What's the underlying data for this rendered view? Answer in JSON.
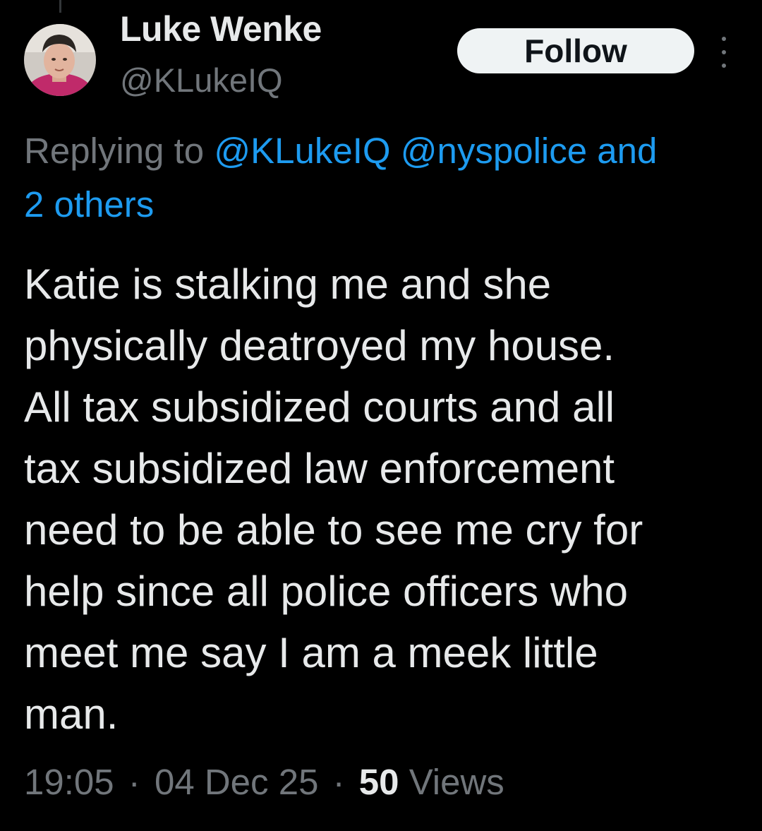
{
  "user": {
    "display_name": "Luke Wenke",
    "handle": "@KLukeIQ"
  },
  "follow_label": "Follow",
  "reply_context": {
    "prefix": "Replying to",
    "mention_1": "@KLukeIQ",
    "mention_2": "@nyspolice",
    "and_word": "and",
    "others": "2 others"
  },
  "tweet_lines": [
    "Katie is stalking me and she",
    "physically deatroyed my house.",
    "All tax subsidized courts and all",
    "tax subsidized law enforcement",
    "need to be able to see me cry for",
    "help since all police officers who",
    "meet me say I am a meek little",
    "man."
  ],
  "meta": {
    "time": "19:05",
    "separator": "·",
    "date": "04 Dec 25",
    "views_count": "50",
    "views_label": "Views"
  },
  "colors": {
    "background": "#000000",
    "text_primary": "#e7e9ea",
    "text_secondary": "#71767b",
    "link": "#1d9bf0",
    "follow_button_bg": "#eff3f4"
  },
  "icons": {
    "more": "more-vertical-icon",
    "avatar": "avatar"
  }
}
